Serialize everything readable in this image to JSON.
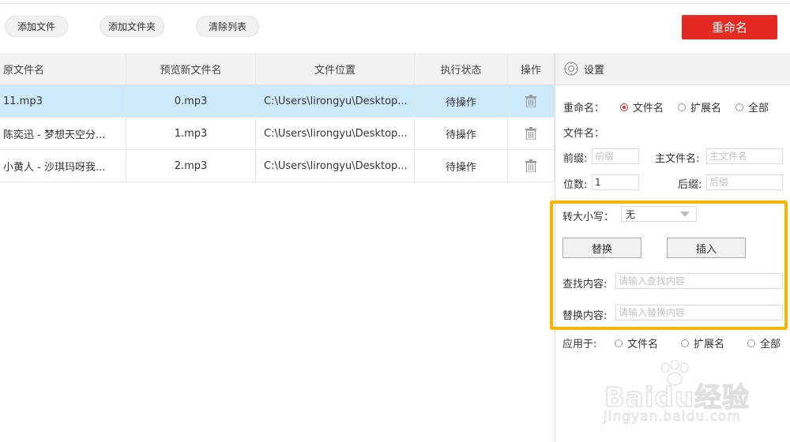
{
  "toolbar": {
    "add_file": "添加文件",
    "add_folder": "添加文件夹",
    "clear_list": "清除列表",
    "rename": "重命名"
  },
  "table": {
    "columns": [
      "原文件名",
      "预览新文件名",
      "文件位置",
      "执行状态",
      "操作"
    ],
    "rows": [
      {
        "original": "11.mp3",
        "preview": "0.mp3",
        "location": "C:\\Users\\lirongyu\\Desktop...",
        "status": "待操作",
        "action_icon": "trash-icon"
      },
      {
        "original": "陈奕迅 - 梦想天空分...",
        "preview": "1.mp3",
        "location": "C:\\Users\\lirongyu\\Desktop...",
        "status": "待操作",
        "action_icon": "trash-icon"
      },
      {
        "original": "小黄人 - 沙琪玛呀我...",
        "preview": "2.mp3",
        "location": "C:\\Users\\lirongyu\\Desktop...",
        "status": "待操作",
        "action_icon": "trash-icon"
      }
    ],
    "selected_row_color": "#cdeafb"
  },
  "settings": {
    "title": "设置",
    "rename_label": "重命名：",
    "rename_options": [
      "文件名",
      "扩展名",
      "全部"
    ],
    "rename_selected": "文件名",
    "filename_label": "文件名：",
    "prefix_label": "前缀:",
    "prefix_placeholder": "前缀",
    "main_name_label": "主文件名:",
    "main_name_placeholder": "主文件名",
    "digits_label": "位数:",
    "digits_value": "1",
    "suffix_label": "后缀:",
    "suffix_placeholder": "后缀",
    "case_label": "转大小写：",
    "case_value": "无",
    "replace_button": "替换",
    "insert_button": "插入",
    "find_label": "查找内容:",
    "find_placeholder": "请输入查找内容",
    "replace_label": "替换内容:",
    "replace_placeholder": "请输入替换内容",
    "apply_label": "应用于:",
    "apply_options": [
      "文件名",
      "扩展名",
      "全部"
    ]
  },
  "watermark": {
    "brand": "Baidu经验",
    "url": "jingyan.baidu.com"
  },
  "colors": {
    "accent_red": "#e42a22",
    "highlight_yellow": "#f7b500",
    "header_gray": "#f2f2f2"
  }
}
